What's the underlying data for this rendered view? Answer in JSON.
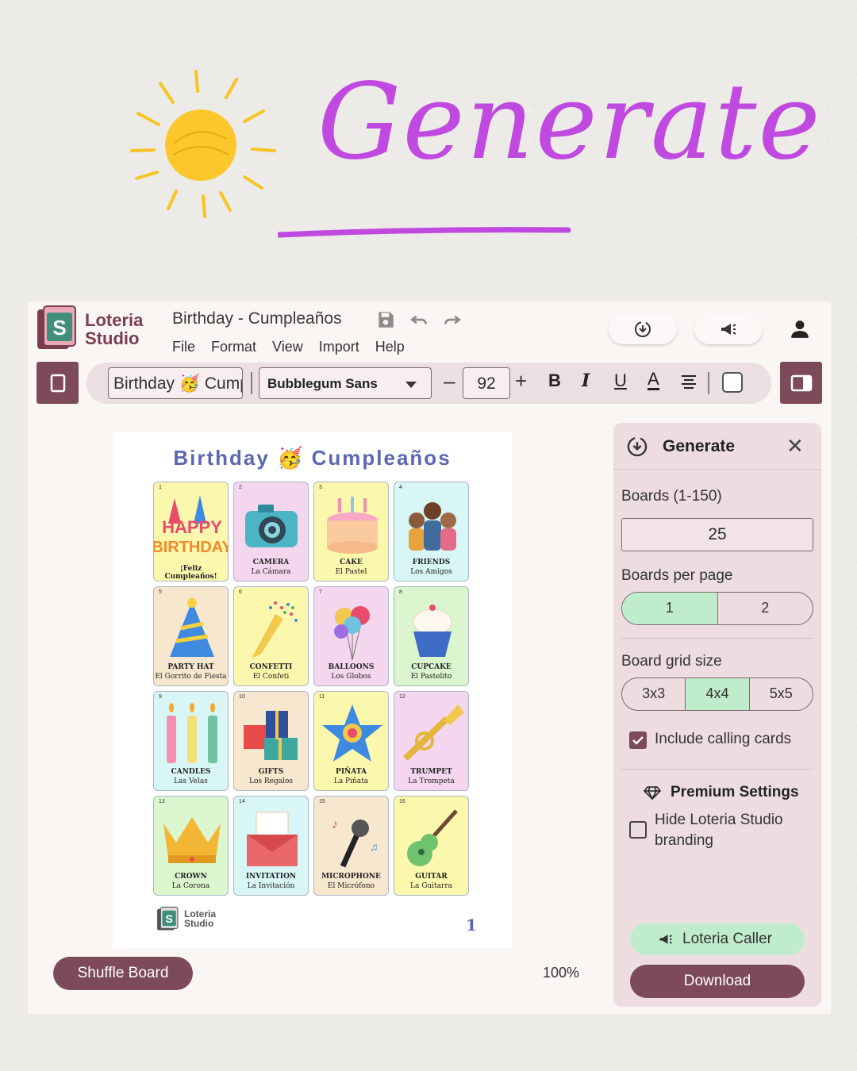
{
  "hero": {
    "title": "Generate"
  },
  "app": {
    "logo_text": [
      "Loteria",
      "Studio"
    ],
    "doc_title": "Birthday - Cumpleaños",
    "menu": [
      "File",
      "Format",
      "View",
      "Import",
      "Help"
    ],
    "toolbar": {
      "title_value": "Birthday 🥳 Cumpleaños",
      "font": "Bubblegum Sans",
      "font_size": "92",
      "bold": "B",
      "italic": "I",
      "underline": "U",
      "color": "A"
    },
    "board": {
      "title": "Birthday 🥳 Cumpleaños",
      "page_number": "1",
      "logo_text": [
        "Loteria",
        "Studio"
      ],
      "cards": [
        {
          "num": "1",
          "name": "¡Feliz Cumpleaños!",
          "sub": ""
        },
        {
          "num": "2",
          "name": "CAMERA",
          "sub": "La Cámara"
        },
        {
          "num": "3",
          "name": "CAKE",
          "sub": "El Pastel"
        },
        {
          "num": "4",
          "name": "FRIENDS",
          "sub": "Los Amigos"
        },
        {
          "num": "5",
          "name": "PARTY HAT",
          "sub": "El Gorrito de Fiesta"
        },
        {
          "num": "6",
          "name": "CONFETTI",
          "sub": "El Confeti"
        },
        {
          "num": "7",
          "name": "BALLOONS",
          "sub": "Los Globos"
        },
        {
          "num": "8",
          "name": "CUPCAKE",
          "sub": "El Pastelito"
        },
        {
          "num": "9",
          "name": "CANDLES",
          "sub": "Las Velas"
        },
        {
          "num": "10",
          "name": "GIFTS",
          "sub": "Los Regalos"
        },
        {
          "num": "11",
          "name": "PIÑATA",
          "sub": "La Piñata"
        },
        {
          "num": "12",
          "name": "TRUMPET",
          "sub": "La Trompeta"
        },
        {
          "num": "13",
          "name": "CROWN",
          "sub": "La Corona"
        },
        {
          "num": "14",
          "name": "INVITATION",
          "sub": "La Invitación"
        },
        {
          "num": "15",
          "name": "MICROPHONE",
          "sub": "El Micrófono"
        },
        {
          "num": "16",
          "name": "GUITAR",
          "sub": "La Guitarra"
        }
      ]
    },
    "shuffle_label": "Shuffle Board",
    "zoom": "100%",
    "panel": {
      "title": "Generate",
      "boards_label": "Boards (1-150)",
      "boards_value": "25",
      "per_page_label": "Boards per page",
      "per_page_options": [
        "1",
        "2"
      ],
      "per_page_selected": "1",
      "grid_label": "Board grid size",
      "grid_options": [
        "3x3",
        "4x4",
        "5x5"
      ],
      "grid_selected": "4x4",
      "calling_cards_label": "Include calling cards",
      "calling_cards_checked": true,
      "premium_title": "Premium Settings",
      "hide_branding_label": "Hide Loteria Studio branding",
      "hide_branding_checked": false,
      "caller_label": "Loteria Caller",
      "download_label": "Download"
    },
    "colors": {
      "accent": "#7d4a5b",
      "mint": "#bfeccb",
      "panel": "#eddde1",
      "hero": "#c04ae0",
      "board_title": "#5a68b4"
    }
  }
}
